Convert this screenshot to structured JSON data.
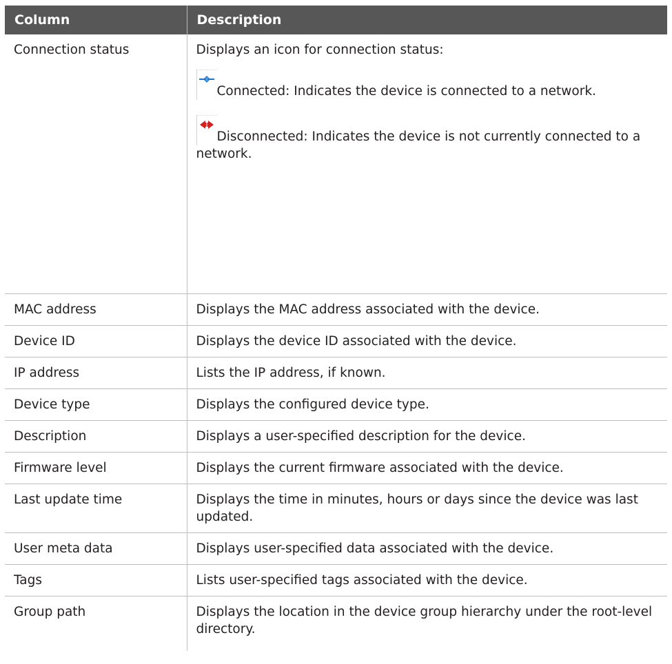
{
  "table": {
    "headers": [
      "Column",
      "Description"
    ],
    "connection_status": {
      "column": "Connection status",
      "intro": "Displays an icon for connection status:",
      "connected": {
        "icon": "connected-plug-icon",
        "color": "#1e73c8",
        "text": "Connected: Indicates the device is connected to a network."
      },
      "disconnected": {
        "icon": "disconnected-plug-icon",
        "color": "#d42020",
        "text": "Disconnected: Indicates the device is not currently connected to a network."
      }
    },
    "rows": [
      {
        "column": "MAC address",
        "description": "Displays the MAC address associated with the device."
      },
      {
        "column": "Device ID",
        "description": "Displays the device ID associated with the device."
      },
      {
        "column": "IP address",
        "description": "Lists the IP address, if known."
      },
      {
        "column": "Device type",
        "description": "Displays the configured device type."
      },
      {
        "column": "Description",
        "description": "Displays a user-specified description for the device."
      },
      {
        "column": "Firmware level",
        "description": "Displays the current firmware associated with the device."
      },
      {
        "column": "Last update time",
        "description": "Displays the time in minutes, hours or days since the device was last updated."
      },
      {
        "column": "User meta data",
        "description": "Displays user-specified data associated with the device."
      },
      {
        "column": "Tags",
        "description": "Lists user-specified tags associated with the device."
      },
      {
        "column": "Group path",
        "description": "Displays the location in the device group hierarchy under the root-level directory."
      }
    ]
  }
}
